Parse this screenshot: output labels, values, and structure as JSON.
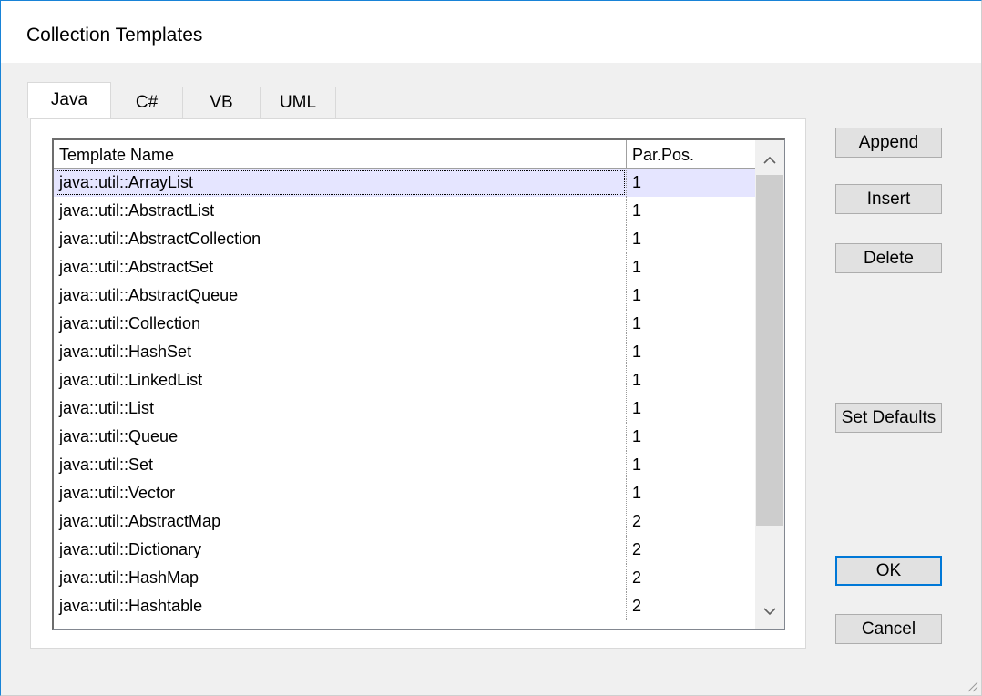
{
  "dialog": {
    "title": "Collection Templates"
  },
  "tabs": [
    {
      "label": "Java",
      "active": true
    },
    {
      "label": "C#",
      "active": false
    },
    {
      "label": "VB",
      "active": false
    },
    {
      "label": "UML",
      "active": false
    }
  ],
  "table": {
    "columns": [
      "Template Name",
      "Par.Pos."
    ],
    "rows": [
      {
        "name": "java::util::ArrayList",
        "pos": "1",
        "selected": true
      },
      {
        "name": "java::util::AbstractList",
        "pos": "1"
      },
      {
        "name": "java::util::AbstractCollection",
        "pos": "1"
      },
      {
        "name": "java::util::AbstractSet",
        "pos": "1"
      },
      {
        "name": "java::util::AbstractQueue",
        "pos": "1"
      },
      {
        "name": "java::util::Collection",
        "pos": "1"
      },
      {
        "name": "java::util::HashSet",
        "pos": "1"
      },
      {
        "name": "java::util::LinkedList",
        "pos": "1"
      },
      {
        "name": "java::util::List",
        "pos": "1"
      },
      {
        "name": "java::util::Queue",
        "pos": "1"
      },
      {
        "name": "java::util::Set",
        "pos": "1"
      },
      {
        "name": "java::util::Vector",
        "pos": "1"
      },
      {
        "name": "java::util::AbstractMap",
        "pos": "2"
      },
      {
        "name": "java::util::Dictionary",
        "pos": "2"
      },
      {
        "name": "java::util::HashMap",
        "pos": "2"
      },
      {
        "name": "java::util::Hashtable",
        "pos": "2"
      }
    ]
  },
  "buttons": {
    "append": "Append",
    "insert": "Insert",
    "delete": "Delete",
    "set_defaults": "Set Defaults",
    "ok": "OK",
    "cancel": "Cancel"
  },
  "icons": {
    "scroll_up": "chevron-up-icon",
    "scroll_down": "chevron-down-icon",
    "resize_grip": "resize-grip-icon"
  },
  "colors": {
    "selected_row": "#e5e5ff",
    "default_button_border": "#0078d7",
    "window_border": "#1883d7"
  }
}
